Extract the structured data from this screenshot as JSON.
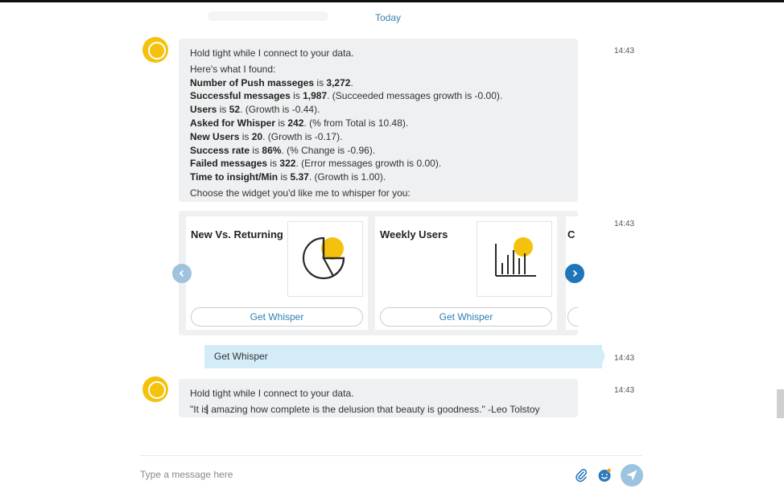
{
  "conversation": {
    "date_separator": "Today"
  },
  "messages": {
    "bot_message_1": {
      "time": "14:43",
      "intro": "Hold tight while I connect to your data.",
      "found_label": "Here's what I found:",
      "stats": [
        {
          "label": "Number of  Push masseges",
          "connector": " is ",
          "value": "3,272",
          "suffix": "."
        },
        {
          "label": "Successful messages",
          "connector": " is ",
          "value": "1,987",
          "suffix": ". (Succeeded messages growth is -0.00)."
        },
        {
          "label": "Users",
          "connector": " is ",
          "value": "52",
          "suffix": ". (Growth is -0.44)."
        },
        {
          "label": "Asked for Whisper",
          "connector": " is ",
          "value": "242",
          "suffix": ". (% from Total is 10.48)."
        },
        {
          "label": "New Users",
          "connector": " is ",
          "value": "20",
          "suffix": ". (Growth is -0.17)."
        },
        {
          "label": "Success rate",
          "connector": " is ",
          "value": "86%",
          "suffix": ". (% Change is -0.96)."
        },
        {
          "label": "Failed messages",
          "connector": " is ",
          "value": "322",
          "suffix": ". (Error messages growth is 0.00)."
        },
        {
          "label": "Time to insight/Min",
          "connector": " is ",
          "value": "5.37",
          "suffix": ". (Growth is 1.00)."
        }
      ],
      "prompt": "Choose the widget you'd like me to whisper for you:"
    },
    "carousel": {
      "time": "14:43",
      "cards": [
        {
          "title": "New Vs. Returning",
          "image_icon": "pie-chart-icon",
          "button_label": "Get Whisper"
        },
        {
          "title": "Weekly Users",
          "image_icon": "bar-chart-icon",
          "button_label": "Get Whisper"
        },
        {
          "title": "C",
          "button_label": ""
        }
      ]
    },
    "user_message": {
      "text": "Get Whisper",
      "time": "14:43"
    },
    "bot_message_2": {
      "time": "14:43",
      "intro": "Hold tight while I connect to your data.",
      "quote": "\"It is amazing how complete is the delusion that beauty is goodness.\" -Leo Tolstoy"
    }
  },
  "composer": {
    "placeholder": "Type a message here",
    "attach_icon": "paperclip-icon",
    "emoji_icon": "emoji-icon",
    "send_icon": "send-icon"
  },
  "colors": {
    "accent": "#1e76b8",
    "bot_avatar": "#f4c20d",
    "bot_bubble": "#eef0f1",
    "user_bubble": "#d3ecf8"
  }
}
